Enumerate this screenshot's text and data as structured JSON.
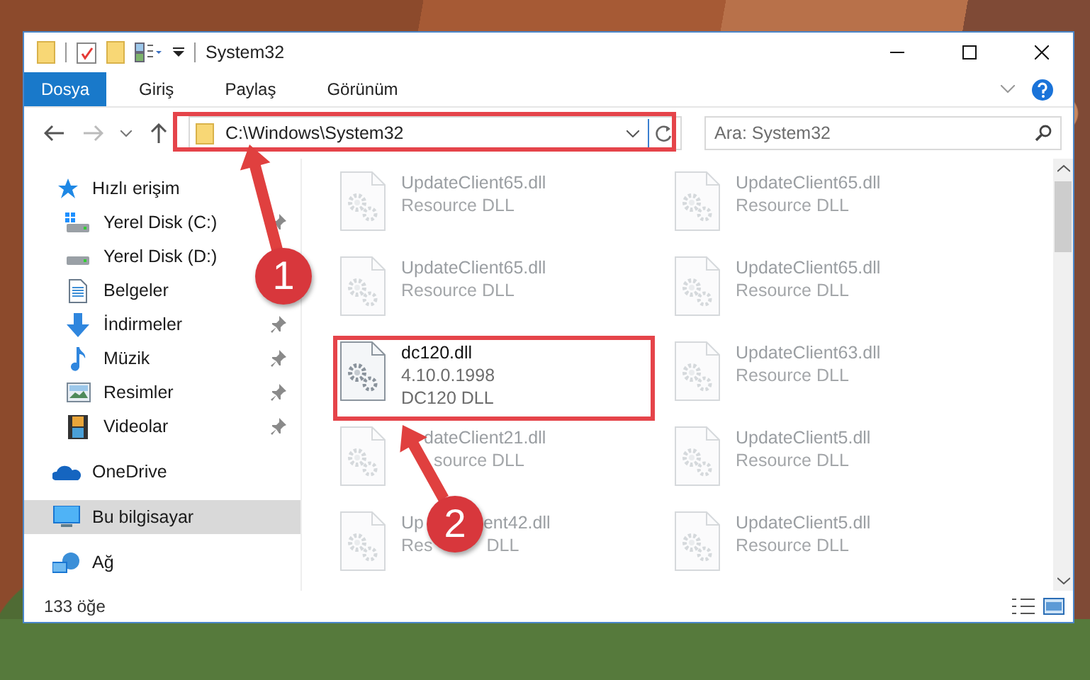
{
  "window": {
    "title": "System32"
  },
  "ribbon_tabs": [
    {
      "label": "Dosya",
      "selected": true
    },
    {
      "label": "Giriş",
      "selected": false
    },
    {
      "label": "Paylaş",
      "selected": false
    },
    {
      "label": "Görünüm",
      "selected": false
    }
  ],
  "address": {
    "value": "C:\\Windows\\System32"
  },
  "search": {
    "placeholder": "Ara: System32"
  },
  "nav": [
    {
      "label": "Hızlı erişim",
      "kind": "quick",
      "selected": false,
      "children": [
        {
          "label": "Yerel Disk (C:)",
          "kind": "drive-c",
          "pinned": true
        },
        {
          "label": "Yerel Disk (D:)",
          "kind": "drive"
        },
        {
          "label": "Belgeler",
          "kind": "documents"
        },
        {
          "label": "İndirmeler",
          "kind": "downloads",
          "pinned": true
        },
        {
          "label": "Müzik",
          "kind": "music",
          "pinned": true
        },
        {
          "label": "Resimler",
          "kind": "pictures",
          "pinned": true
        },
        {
          "label": "Videolar",
          "kind": "videos",
          "pinned": true
        }
      ]
    },
    {
      "label": "OneDrive",
      "kind": "cloud",
      "selected": false
    },
    {
      "label": "Bu bilgisayar",
      "kind": "computer",
      "selected": true
    },
    {
      "label": "Ağ",
      "kind": "network",
      "selected": false
    }
  ],
  "files": [
    {
      "kind": "whole",
      "name": "UpdateClient65.dll",
      "lines": [
        "Resource DLL"
      ],
      "dimmed": true
    },
    {
      "kind": "whole",
      "name": "UpdateClient65.dll",
      "lines": [
        "Resource DLL"
      ],
      "dimmed": true
    },
    {
      "kind": "whole",
      "name": "UpdateClient65.dll",
      "lines": [
        "Resource DLL"
      ],
      "dimmed": true
    },
    {
      "kind": "whole",
      "name": "UpdateClient65.dll",
      "lines": [
        "Resource DLL"
      ],
      "dimmed": true
    },
    {
      "kind": "whole",
      "name": "dc120.dll",
      "lines": [
        "4.10.0.1998",
        "DC120 DLL"
      ],
      "dimmed": false
    },
    {
      "kind": "whole",
      "name": "UpdateClient63.dll",
      "lines": [
        "Resource DLL"
      ],
      "dimmed": true
    },
    {
      "kind": "cut",
      "name": "dateClient21.dll",
      "lines": [
        "source DLL"
      ],
      "dimmed": true
    },
    {
      "kind": "whole",
      "name": "UpdateClient5.dll",
      "lines": [
        "Resource DLL"
      ],
      "dimmed": true
    },
    {
      "kind": "split",
      "name": "Up",
      "name_tail": "ent42.dll",
      "lines": [
        "Res"
      ],
      "line_tails": [
        "DLL"
      ],
      "dimmed": true
    },
    {
      "kind": "whole",
      "name": "UpdateClient5.dll",
      "lines": [
        "Resource DLL"
      ],
      "dimmed": true
    }
  ],
  "status_bar": {
    "count": "133 öğe"
  },
  "annotations": [
    {
      "label": "1"
    },
    {
      "label": "2"
    }
  ]
}
